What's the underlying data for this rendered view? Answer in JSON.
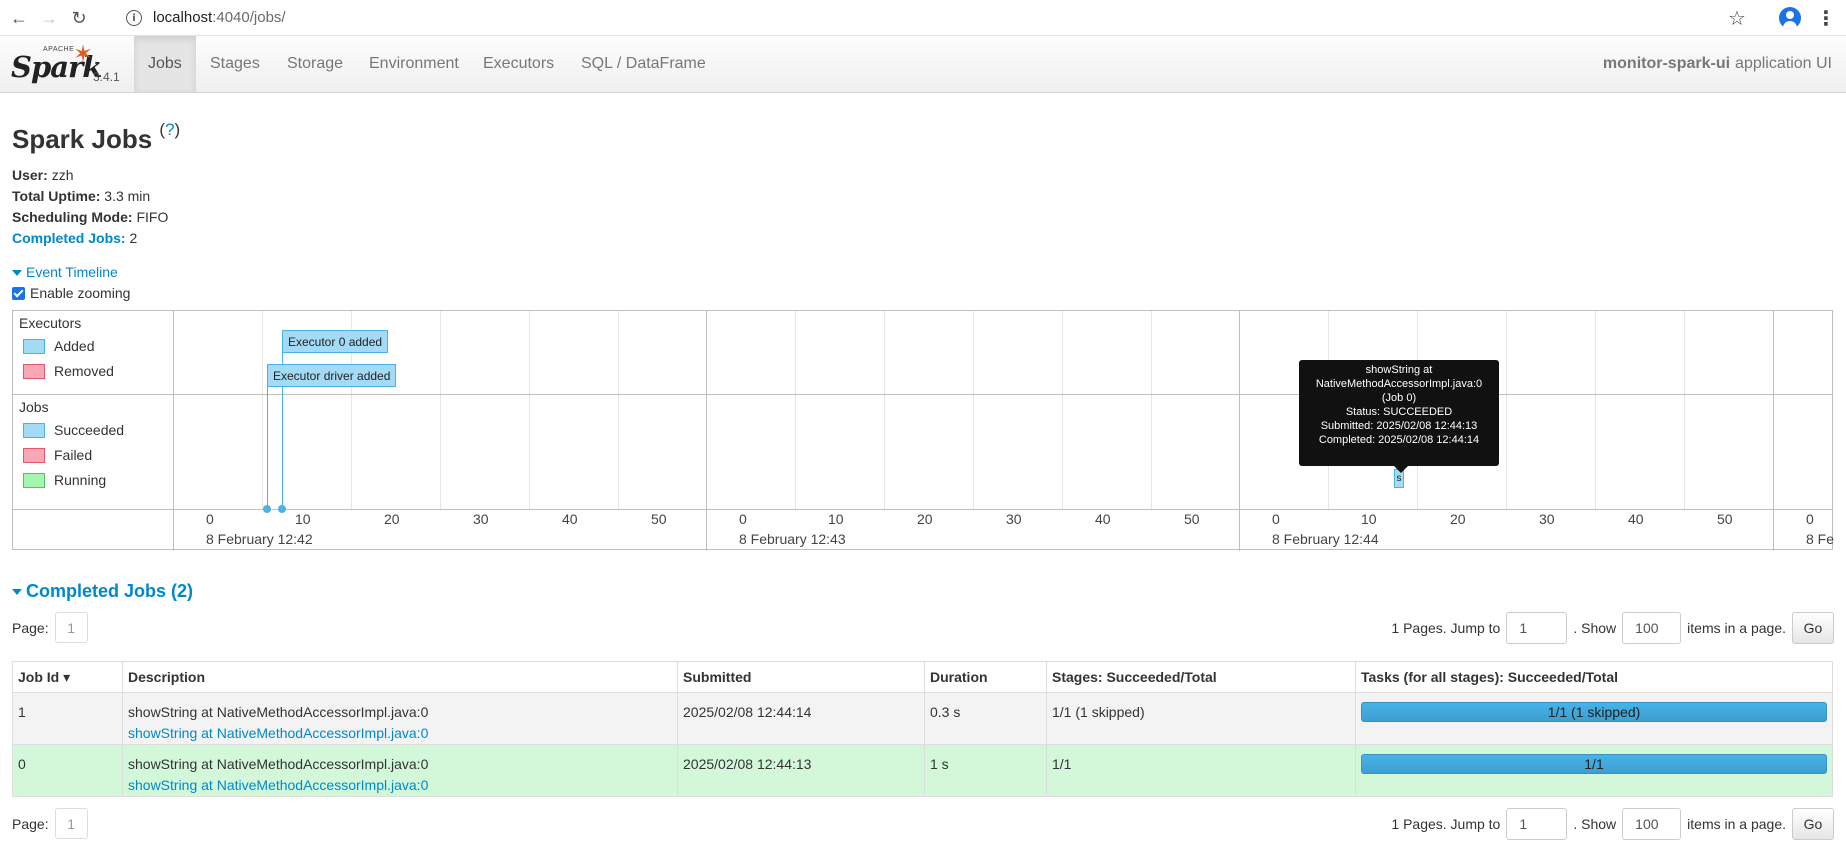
{
  "browser": {
    "url_host": "localhost",
    "url_rest": ":4040/jobs/",
    "icons": [
      "back-arrow-icon",
      "forward-arrow-icon",
      "reload-icon",
      "site-info-icon",
      "bookmark-star-icon",
      "profile-icon",
      "menu-kebab-icon"
    ]
  },
  "navbar": {
    "brand_apache": "APACHE",
    "brand_name": "Spark",
    "version": "3.4.1",
    "tabs": [
      "Jobs",
      "Stages",
      "Storage",
      "Environment",
      "Executors",
      "SQL / DataFrame"
    ],
    "active_tab": "Jobs",
    "app_name": "monitor-spark-ui",
    "app_suffix": "application UI"
  },
  "page": {
    "title": "Spark Jobs",
    "help": "?",
    "user_label": "User:",
    "user": "zzh",
    "uptime_label": "Total Uptime:",
    "uptime": "3.3 min",
    "mode_label": "Scheduling Mode:",
    "mode": "FIFO",
    "completed_label": "Completed Jobs:",
    "completed": "2"
  },
  "timeline": {
    "toggle": "Event Timeline",
    "zoom_label": "Enable zooming",
    "zoom_checked": true,
    "executors_label": "Executors",
    "executor_legend": [
      {
        "label": "Added",
        "fill": "#a3daf6",
        "border": "#4cb3e8"
      },
      {
        "label": "Removed",
        "fill": "#f6a9b4",
        "border": "#e5566b"
      }
    ],
    "jobs_label": "Jobs",
    "job_legend": [
      {
        "label": "Succeeded",
        "fill": "#a3daf6",
        "border": "#4cb3e8"
      },
      {
        "label": "Failed",
        "fill": "#f6a9b4",
        "border": "#e5566b"
      },
      {
        "label": "Running",
        "fill": "#a4f5b0",
        "border": "#4cc65e"
      }
    ],
    "executor_events": [
      "Executor 0 added",
      "Executor driver added"
    ],
    "job_box_label": "s",
    "tooltip": {
      "line1": "showString at",
      "line2": "NativeMethodAccessorImpl.java:0",
      "line3": "(Job 0)",
      "status": "Status: SUCCEEDED",
      "submitted": "Submitted: 2025/02/08 12:44:13",
      "completed": "Completed: 2025/02/08 12:44:14"
    },
    "tick_labels": [
      "0",
      "10",
      "20",
      "30",
      "40",
      "50",
      "0",
      "10",
      "20",
      "30",
      "40",
      "50",
      "0",
      "10",
      "20",
      "30",
      "40",
      "50",
      "0"
    ],
    "date_labels": [
      "8 February 12:42",
      "8 February 12:43",
      "8 February 12:44",
      "8 Fe"
    ]
  },
  "completed_jobs": {
    "header": "Completed Jobs (2)",
    "page_label": "Page:",
    "page_value": "1",
    "pages_text": "1 Pages. Jump to",
    "jump_value": "1",
    "show_text": ". Show",
    "show_value": "100",
    "items_text": "items in a page.",
    "go_label": "Go",
    "columns": [
      "Job Id ▾",
      "Description",
      "Submitted",
      "Duration",
      "Stages: Succeeded/Total",
      "Tasks (for all stages): Succeeded/Total"
    ],
    "rows": [
      {
        "id": "1",
        "desc": "showString at NativeMethodAccessorImpl.java:0",
        "desc_link": "showString at NativeMethodAccessorImpl.java:0",
        "submitted": "2025/02/08 12:44:14",
        "duration": "0.3 s",
        "stages": "1/1 (1 skipped)",
        "tasks": "1/1 (1 skipped)",
        "tasks_fraction": 1.0
      },
      {
        "id": "0",
        "desc": "showString at NativeMethodAccessorImpl.java:0",
        "desc_link": "showString at NativeMethodAccessorImpl.java:0",
        "submitted": "2025/02/08 12:44:13",
        "duration": "1 s",
        "stages": "1/1",
        "tasks": "1/1",
        "tasks_fraction": 1.0
      }
    ]
  }
}
